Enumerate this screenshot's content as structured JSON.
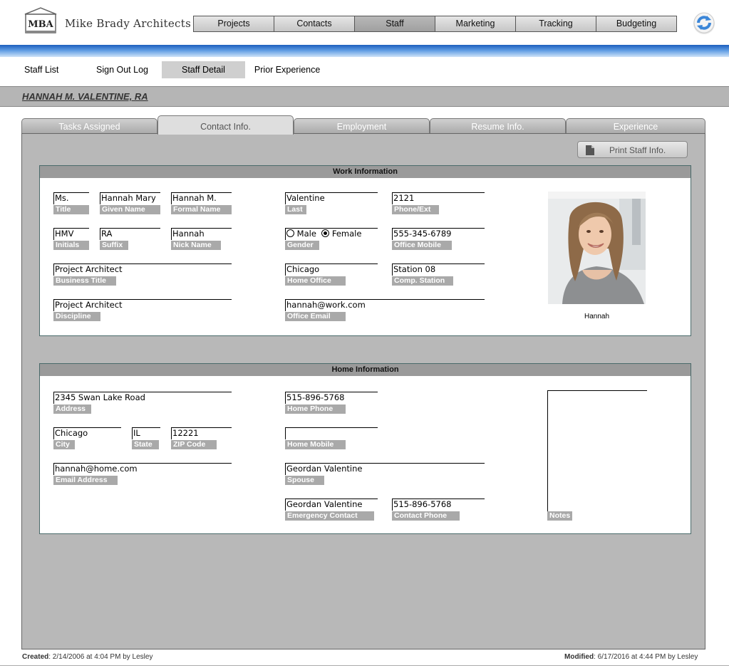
{
  "app": {
    "logo_abbr": "MBA",
    "logo_text": "Mike Brady Architects"
  },
  "nav": [
    "Projects",
    "Contacts",
    "Staff",
    "Marketing",
    "Tracking",
    "Budgeting"
  ],
  "subnav": [
    "Staff List",
    "Sign Out Log",
    "Staff Detail",
    "Prior Experience"
  ],
  "banner": "HANNAH M. VALENTINE, RA",
  "tabs": [
    "Tasks Assigned",
    "Contact Info.",
    "Employment",
    "Resume Info.",
    "Experience"
  ],
  "print_button": "Print Staff Info.",
  "work": {
    "header": "Work Information",
    "title": {
      "value": "Ms.",
      "label": "Title"
    },
    "given_name": {
      "value": "Hannah Mary",
      "label": "Given Name"
    },
    "formal_name": {
      "value": "Hannah M.",
      "label": "Formal Name"
    },
    "last": {
      "value": "Valentine",
      "label": "Last"
    },
    "phone_ext": {
      "value": "2121",
      "label": "Phone/Ext"
    },
    "initials": {
      "value": "HMV",
      "label": "Initials"
    },
    "suffix": {
      "value": "RA",
      "label": "Suffix"
    },
    "nick_name": {
      "value": "Hannah",
      "label": "Nick Name"
    },
    "gender": {
      "label": "Gender",
      "male": "Male",
      "female": "Female",
      "selected": "Female"
    },
    "office_mobile": {
      "value": "555-345-6789",
      "label": "Office Mobile"
    },
    "business_title": {
      "value": "Project Architect",
      "label": "Business Title"
    },
    "home_office": {
      "value": "Chicago",
      "label": "Home Office"
    },
    "comp_station": {
      "value": "Station 08",
      "label": "Comp. Station"
    },
    "discipline": {
      "value": "Project Architect",
      "label": "Discipline"
    },
    "office_email": {
      "value": "hannah@work.com",
      "label": "Office Email"
    },
    "photo_caption": "Hannah"
  },
  "home": {
    "header": "Home Information",
    "address": {
      "value": "2345 Swan Lake Road",
      "label": "Address"
    },
    "home_phone": {
      "value": "515-896-5768",
      "label": "Home Phone"
    },
    "city": {
      "value": "Chicago",
      "label": "City"
    },
    "state": {
      "value": "IL",
      "label": "State"
    },
    "zip": {
      "value": "12221",
      "label": "ZIP Code"
    },
    "home_mobile": {
      "value": "",
      "label": "Home Mobile"
    },
    "email": {
      "value": "hannah@home.com",
      "label": "Email Address"
    },
    "spouse": {
      "value": "Geordan Valentine",
      "label": "Spouse"
    },
    "emergency_contact": {
      "value": "Geordan Valentine",
      "label": "Emergency Contact"
    },
    "contact_phone": {
      "value": "515-896-5768",
      "label": "Contact Phone"
    },
    "notes": {
      "value": "",
      "label": "Notes"
    }
  },
  "footer": {
    "created_label": "Created",
    "created_value": ": 2/14/2006 at 4:04 PM by Lesley",
    "modified_label": "Modified",
    "modified_value": ": 6/17/2016 at 4:44 PM by Lesley"
  },
  "colors": {
    "accent_blue": "#1d5fbd",
    "panel_gray": "#b8b8b8",
    "label_gray": "#a9a9a9"
  }
}
